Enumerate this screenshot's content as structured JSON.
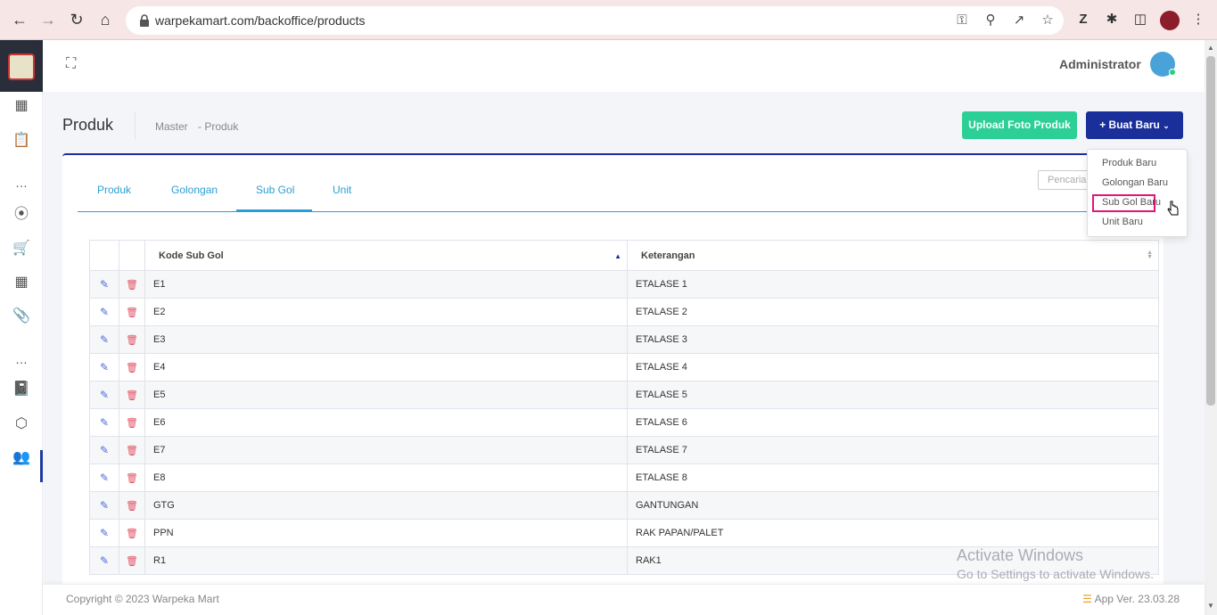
{
  "browser": {
    "url": "warpekamart.com/backoffice/products"
  },
  "header": {
    "user_name": "Administrator"
  },
  "page": {
    "title": "Produk",
    "breadcrumb": [
      "Master",
      "- Produk"
    ],
    "upload_button": "Upload Foto Produk",
    "new_button": "+ Buat Baru"
  },
  "tabs": [
    {
      "label": "Produk"
    },
    {
      "label": "Golongan"
    },
    {
      "label": "Sub Gol",
      "active": true
    },
    {
      "label": "Unit"
    }
  ],
  "search": {
    "placeholder": "Pencarian"
  },
  "dropdown": {
    "items": [
      {
        "label": "Produk Baru"
      },
      {
        "label": "Golongan Baru"
      },
      {
        "label": "Sub Gol Baru",
        "highlighted": true
      },
      {
        "label": "Unit Baru"
      }
    ]
  },
  "table": {
    "columns": [
      "Kode Sub Gol",
      "Keterangan"
    ],
    "rows": [
      {
        "kode": "E1",
        "ket": "ETALASE 1"
      },
      {
        "kode": "E2",
        "ket": "ETALASE 2"
      },
      {
        "kode": "E3",
        "ket": "ETALASE 3"
      },
      {
        "kode": "E4",
        "ket": "ETALASE 4"
      },
      {
        "kode": "E5",
        "ket": "ETALASE 5"
      },
      {
        "kode": "E6",
        "ket": "ETALASE 6"
      },
      {
        "kode": "E7",
        "ket": "ETALASE 7"
      },
      {
        "kode": "E8",
        "ket": "ETALASE 8"
      },
      {
        "kode": "GTG",
        "ket": "GANTUNGAN"
      },
      {
        "kode": "PPN",
        "ket": "RAK PAPAN/PALET"
      },
      {
        "kode": "R1",
        "ket": "RAK1"
      }
    ]
  },
  "watermark": {
    "line1": "Activate Windows",
    "line2": "Go to Settings to activate Windows."
  },
  "footer": {
    "copyright": "Copyright © 2023 Warpeka Mart",
    "version": "App Ver. 23.03.28"
  },
  "icons": {
    "sidebar": [
      "grid-icon",
      "clipboard-icon",
      "more-icon",
      "broadcast-icon",
      "cart-icon",
      "calculator-icon",
      "paperclip-icon",
      "more-icon",
      "book-icon",
      "box-icon",
      "users-icon"
    ]
  },
  "colors": {
    "primary": "#1a2f9a",
    "success": "#2ccf95",
    "link": "#2a9fd6",
    "highlight": "#e0157a"
  }
}
